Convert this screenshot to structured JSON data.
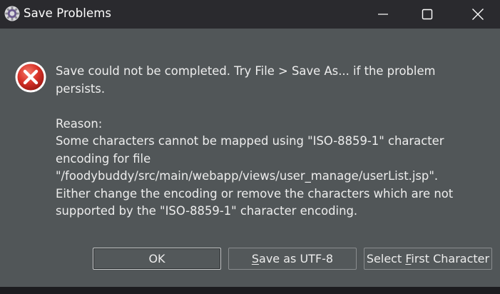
{
  "window": {
    "title": "Save Problems",
    "app_icon": "gear-icon"
  },
  "titlebar_buttons": {
    "minimize": "minimize-icon",
    "maximize": "maximize-icon",
    "close": "close-icon"
  },
  "dialog": {
    "icon": "error-icon",
    "message_line1": "Save could not be completed. Try File > Save As... if the problem",
    "message_line2": "persists.",
    "reason_label": "Reason:",
    "reason_lines": [
      "Some characters cannot be mapped using \"ISO-8859-1\" character",
      "encoding for file",
      "\"/foodybuddy/src/main/webapp/views/user_manage/userList.jsp\".",
      "Either change the encoding or remove the characters which are not",
      "supported by the \"ISO-8859-1\" character encoding."
    ]
  },
  "buttons": {
    "ok": "OK",
    "save_utf8_mnemonic": "S",
    "save_utf8_rest": "ave as UTF-8",
    "select_first_pre": "Select ",
    "select_first_mnemonic": "F",
    "select_first_rest": "irst Character"
  },
  "colors": {
    "dialog_bg": "#515658",
    "titlebar_bg": "#2a2a2e",
    "error_red": "#d9342b"
  }
}
